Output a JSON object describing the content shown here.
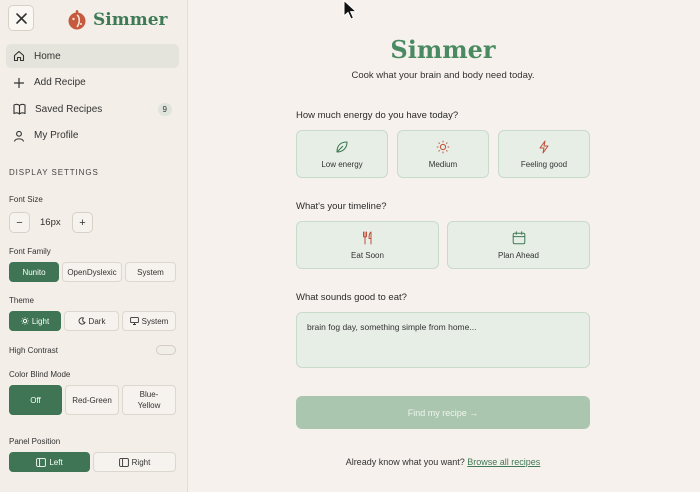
{
  "app": {
    "brand": "Simmer"
  },
  "nav": [
    {
      "label": "Home",
      "icon": "home-icon",
      "active": true
    },
    {
      "label": "Add Recipe",
      "icon": "plus-icon"
    },
    {
      "label": "Saved Recipes",
      "icon": "book-icon",
      "badge": "9"
    },
    {
      "label": "My Profile",
      "icon": "user-icon"
    }
  ],
  "settings": {
    "title": "DISPLAY SETTINGS",
    "font_size": {
      "label": "Font Size",
      "value": "16px",
      "decrease": "−",
      "increase": "+"
    },
    "font_family": {
      "label": "Font Family",
      "options": [
        "Nunito",
        "OpenDyslexic",
        "System"
      ],
      "selected": "Nunito"
    },
    "theme": {
      "label": "Theme",
      "options": [
        "Light",
        "Dark",
        "System"
      ],
      "selected": "Light"
    },
    "high_contrast": {
      "label": "High Contrast",
      "on": false
    },
    "color_blind": {
      "label": "Color Blind Mode",
      "options": [
        "Off",
        "Red-Green",
        "Blue-\nYellow"
      ],
      "selected": "Off"
    },
    "panel_position": {
      "label": "Panel Position",
      "options": [
        "Left",
        "Right"
      ],
      "selected": "Left"
    }
  },
  "main": {
    "title": "Simmer",
    "subtitle": "Cook what your brain and body need today.",
    "energy": {
      "question": "How much energy do you have today?",
      "options": [
        {
          "label": "Low energy",
          "icon": "leaf-icon"
        },
        {
          "label": "Medium",
          "icon": "sun-icon"
        },
        {
          "label": "Feeling good",
          "icon": "lightning-icon"
        }
      ]
    },
    "timeline": {
      "question": "What's your timeline?",
      "options": [
        {
          "label": "Eat Soon",
          "icon": "utensils-icon"
        },
        {
          "label": "Plan Ahead",
          "icon": "calendar-icon"
        }
      ]
    },
    "craving": {
      "question": "What sounds good to eat?",
      "value": "brain fog day, something simple from home..."
    },
    "submit_label": "Find my recipe →",
    "footer_text": "Already know what you want?",
    "footer_link": "Browse all recipes"
  },
  "colors": {
    "accent": "#3f7454",
    "title": "#4a8a62",
    "card": "#e7eee6",
    "icon": "#c0503a"
  }
}
